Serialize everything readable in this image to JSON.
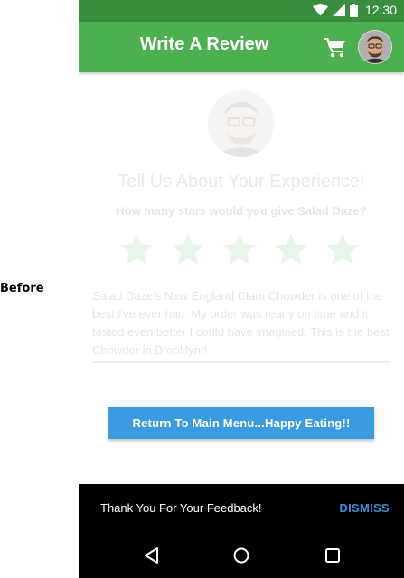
{
  "side_label": "Before",
  "status_bar": {
    "time": "12:30"
  },
  "app_bar": {
    "title": "Write A Review"
  },
  "content": {
    "heading": "Tell Us About Your Experience!",
    "question": "How many stars would you give Salad Daze?",
    "star_rating": 0,
    "star_count": 5,
    "review_text": "Salad Daze's New England Clam Chowder is one of the best I've ever had. My order was ready on time and it tasted even better I could have imagined. This is the best Chowder in Brooklyn!!"
  },
  "return_button": {
    "label": "Return To Main Menu...Happy Eating!!"
  },
  "snackbar": {
    "message": "Thank You For Your Feedback!",
    "action": "DISMISS"
  },
  "colors": {
    "primary": "#4caf50",
    "status_bar": "#388e3c",
    "button": "#3a9ae2",
    "snackbar_action": "#3a8fd6"
  }
}
